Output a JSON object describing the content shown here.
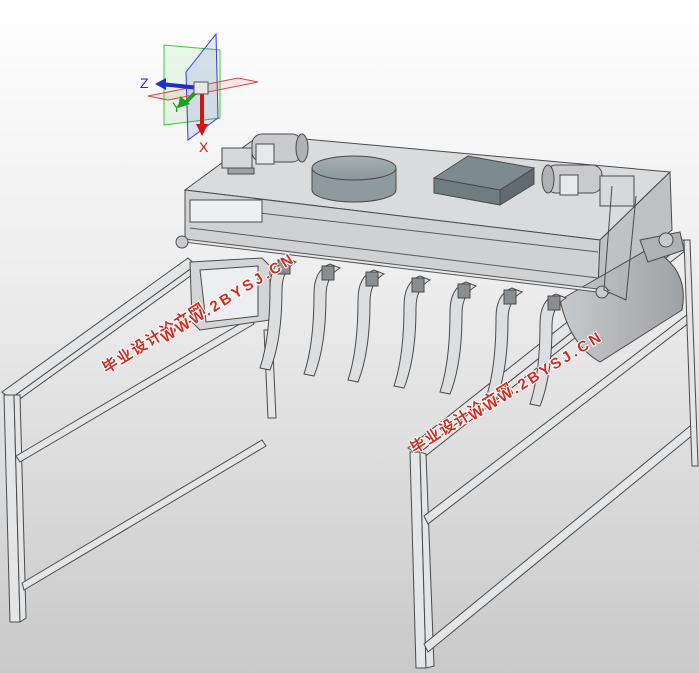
{
  "triad": {
    "z_label": "Z",
    "y_label": "Y",
    "x_label": "X",
    "colors": {
      "z": "#1f2fd6",
      "y": "#19a319",
      "x": "#d41414",
      "plane_green": "#3ccc3c",
      "plane_red": "#e04040",
      "plane_blue": "#3a3ae0"
    }
  },
  "model": {
    "colors": {
      "body": "#d4d6d8",
      "edge": "#4a4a4a",
      "dark": "#6e7276",
      "cylinder": "#8e9a9e",
      "box": "#6f7d80"
    },
    "parts": [
      "housing",
      "cylinder-hopper",
      "square-hopper",
      "motor-left",
      "motor-right",
      "curved-tines",
      "shaft",
      "support-frame-left",
      "support-frame-right",
      "side-cover"
    ]
  },
  "watermarks": [
    {
      "cn": "毕业设计论文网",
      "url": "WWW.2BYSJ.CN"
    },
    {
      "cn": "毕业设计论文网",
      "url": "WWW.2BYSJ.CN"
    }
  ]
}
